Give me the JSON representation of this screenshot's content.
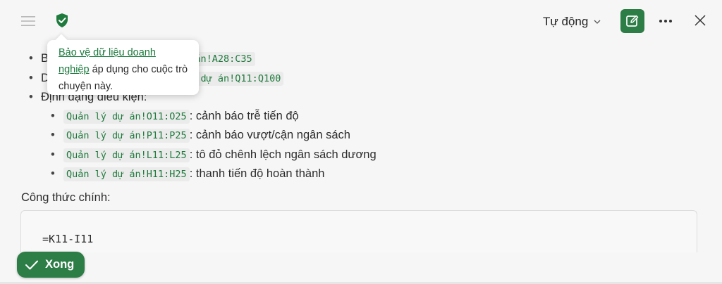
{
  "header": {
    "menu_icon": "hamburger-icon",
    "protection_icon": "shield-check-icon",
    "mode_label": "Tự động",
    "new_chat_icon": "compose-icon",
    "more_icon": "ellipsis-icon",
    "close_icon": "close-icon",
    "accent": "#2d7d46"
  },
  "tooltip": {
    "link_text": "Bảo vệ dữ liệu doanh nghiệp",
    "body_text": " áp dụng cho cuộc trò chuyện này."
  },
  "content": {
    "top_bullets": [
      {
        "prefix": "B",
        "code": "lý dự án!A28:C35",
        "text": ""
      },
      {
        "prefix": "D",
        "code": "Quản lý dự án!Q11:Q100",
        "text": ""
      },
      {
        "prefix": "Định dạng điều kiện:",
        "code": "",
        "text": ""
      }
    ],
    "sub_bullets": [
      {
        "code": "Quản lý dự án!O11:O25",
        "text": ": cảnh báo trễ tiến độ"
      },
      {
        "code": "Quản lý dự án!P11:P25",
        "text": ": cảnh báo vượt/cận ngân sách"
      },
      {
        "code": "Quản lý dự án!L11:L25",
        "text": ": tô đỏ chênh lệch ngân sách dương"
      },
      {
        "code": "Quản lý dự án!H11:H25",
        "text": ": thanh tiến độ hoàn thành"
      }
    ],
    "formula_heading": "Công thức chính:",
    "formula_code": "=K11-I11"
  },
  "footer": {
    "done_label": "Xong",
    "done_icon": "checkmark-icon"
  }
}
